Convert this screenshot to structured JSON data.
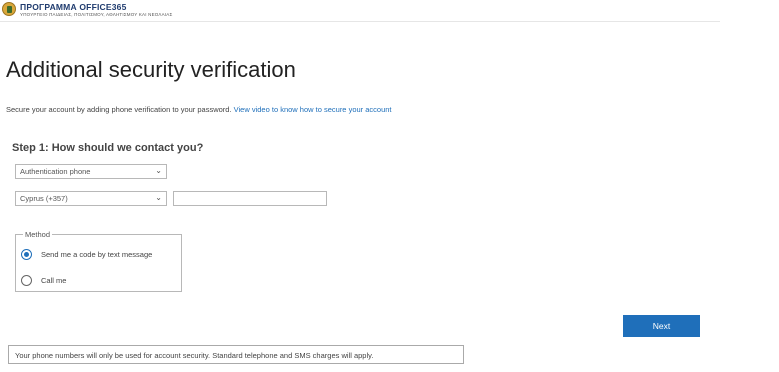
{
  "header": {
    "brand_title": "ΠΡΟΓΡΑΜΜΑ OFFICE365",
    "brand_subtitle": "ΥΠΟΥΡΓΕΙΟ ΠΑΙΔΕΙΑΣ, ΠΟΛΙΤΙΣΜΟΥ, ΑΘΛΗΤΙΣΜΟΥ ΚΑΙ ΝΕΟΛΑΙΑΣ"
  },
  "page": {
    "title": "Additional security verification",
    "intro_text": "Secure your account by adding phone verification to your password. ",
    "intro_link": "View video to know how to secure your account"
  },
  "step1": {
    "title": "Step 1: How should we contact you?",
    "contact_method_selected": "Authentication phone",
    "country_selected": "Cyprus (+357)",
    "phone_value": ""
  },
  "method": {
    "legend": "Method",
    "options": [
      {
        "label": "Send me a code by text message",
        "checked": true
      },
      {
        "label": "Call me",
        "checked": false
      }
    ]
  },
  "actions": {
    "next_label": "Next"
  },
  "footer": {
    "notice": "Your phone numbers will only be used for account security. Standard telephone and SMS charges will apply."
  },
  "colors": {
    "accent": "#1f6fba",
    "brand_text": "#1f3b6e",
    "border": "#b8b8b8"
  }
}
